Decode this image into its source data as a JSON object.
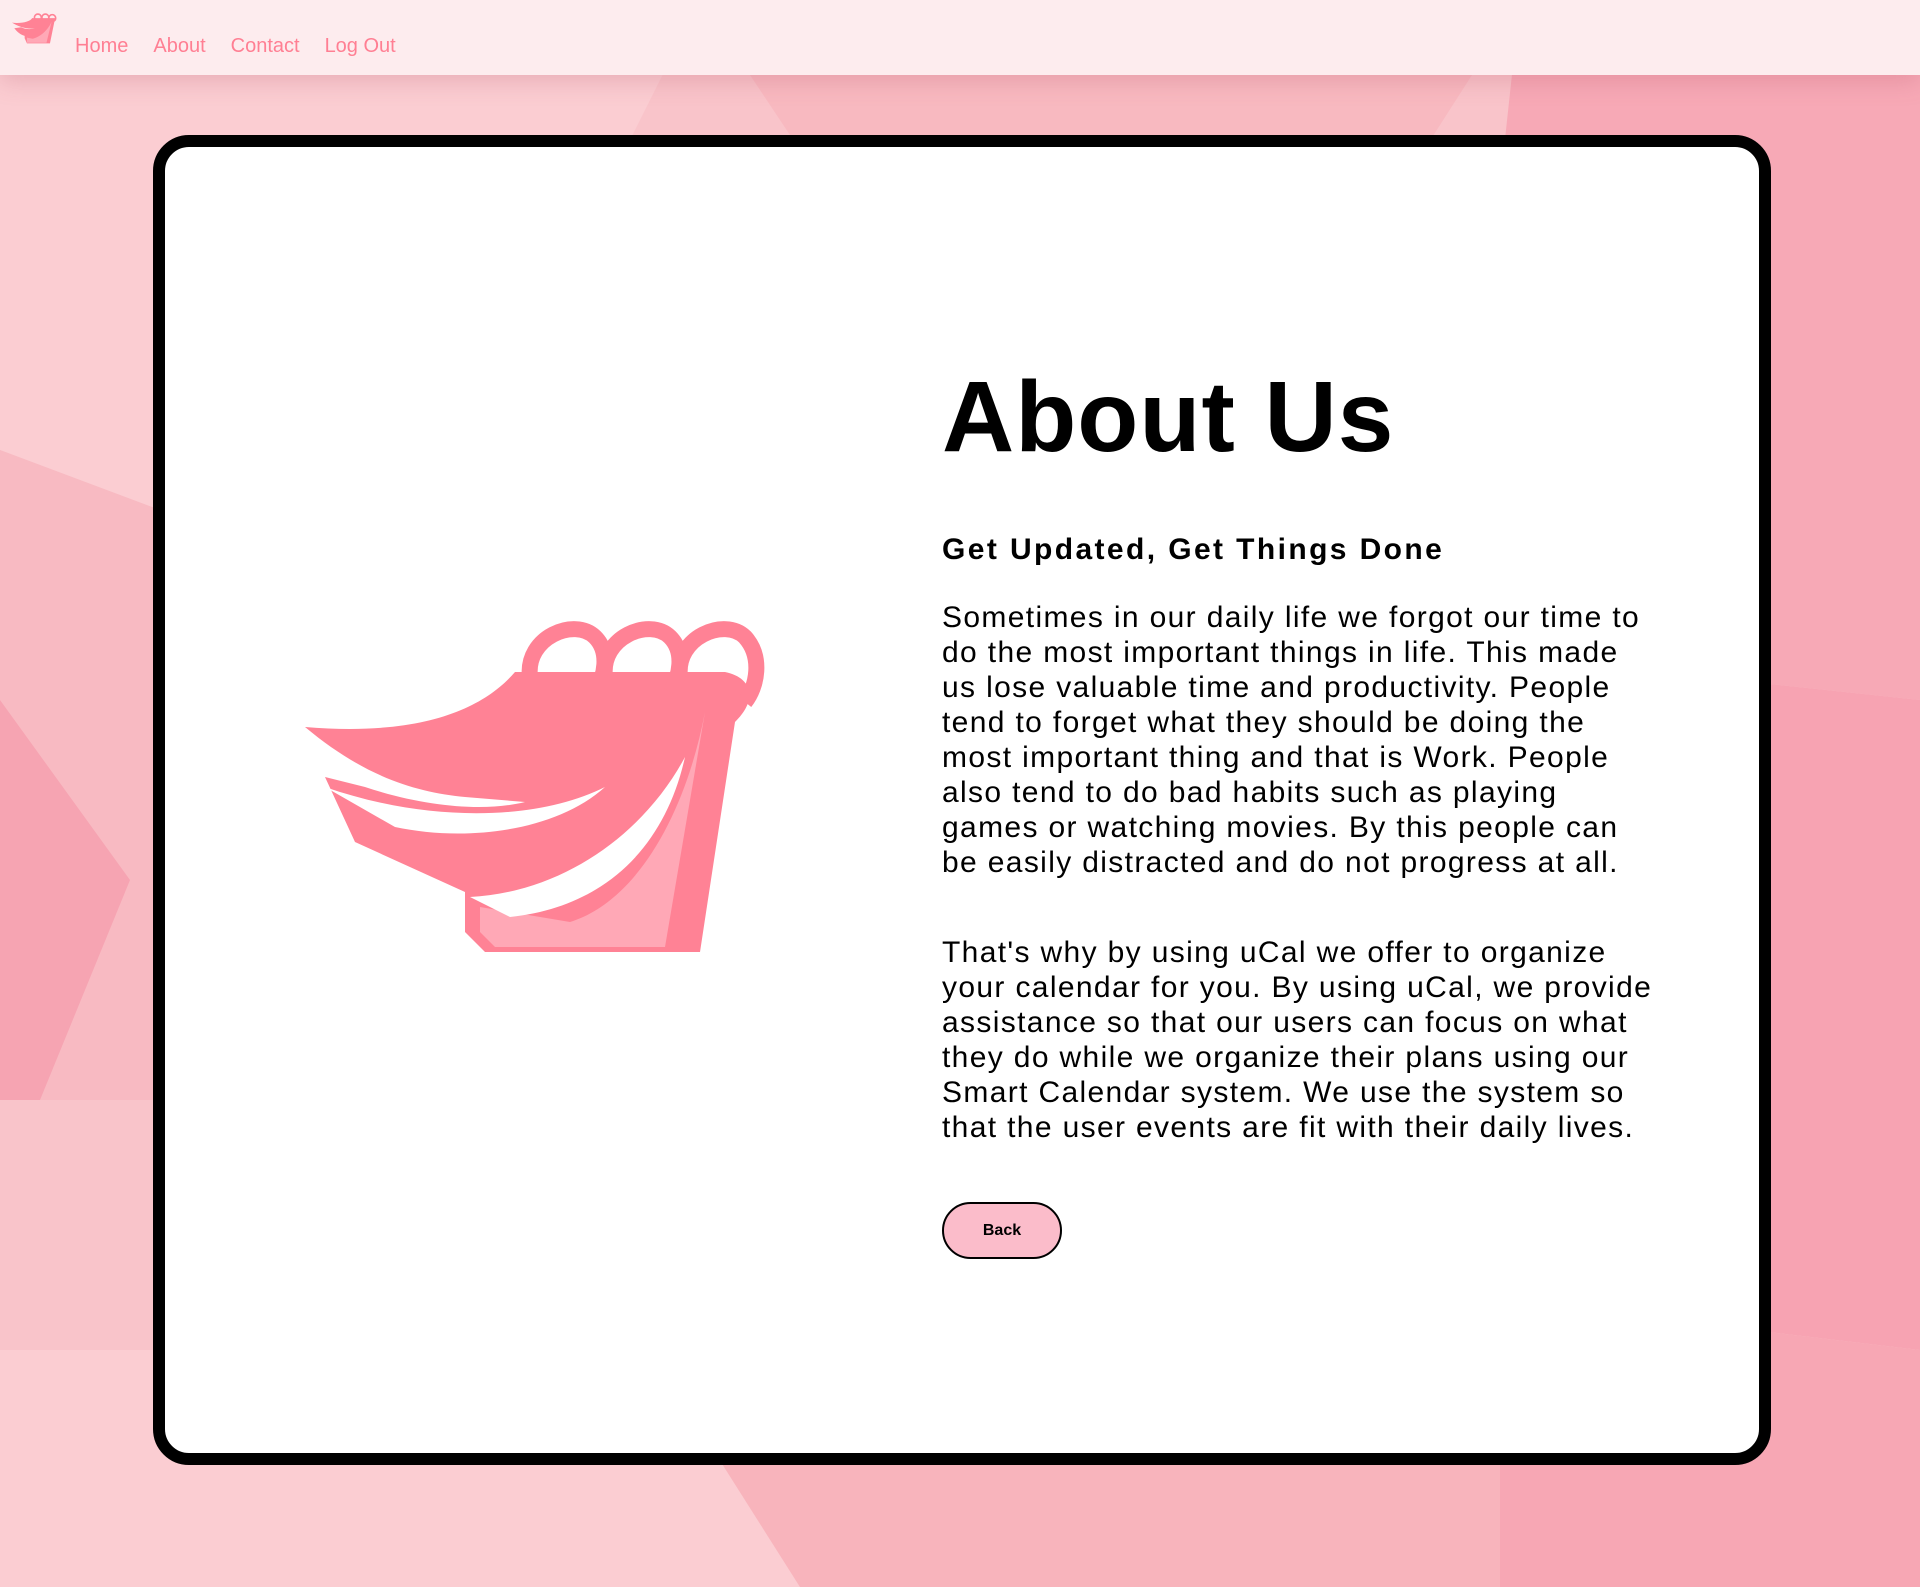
{
  "nav": {
    "links": [
      {
        "label": "Home"
      },
      {
        "label": "About"
      },
      {
        "label": "Contact"
      },
      {
        "label": "Log Out"
      }
    ]
  },
  "about": {
    "title": "About Us",
    "subtitle": "Get Updated, Get Things Done",
    "paragraphs": [
      "Sometimes in our daily life we forgot our time to do the most important things in life. This made us lose valuable time and productivity. People tend to forget what they should be doing the most important thing and that is Work. People also tend to do bad habits such as playing games or watching movies. By this people can be easily distracted and do not progress at all.",
      "That's why by using uCal we offer to organize your calendar for you. By using uCal, we provide assistance so that our users can focus on what they do while we organize their plans using our Smart Calendar system. We use the system so that the user events are fit with their daily lives."
    ],
    "back_label": "Back"
  },
  "theme": {
    "brand_pink": "#ff8295",
    "brand_pink_light": "#ffa8b6",
    "nav_bg": "#fdecee",
    "button_bg": "#fbbcca",
    "card_border": "#000000"
  },
  "icons": {
    "nav_logo": "calendar-logo-icon",
    "hero_logo": "calendar-logo-icon"
  }
}
